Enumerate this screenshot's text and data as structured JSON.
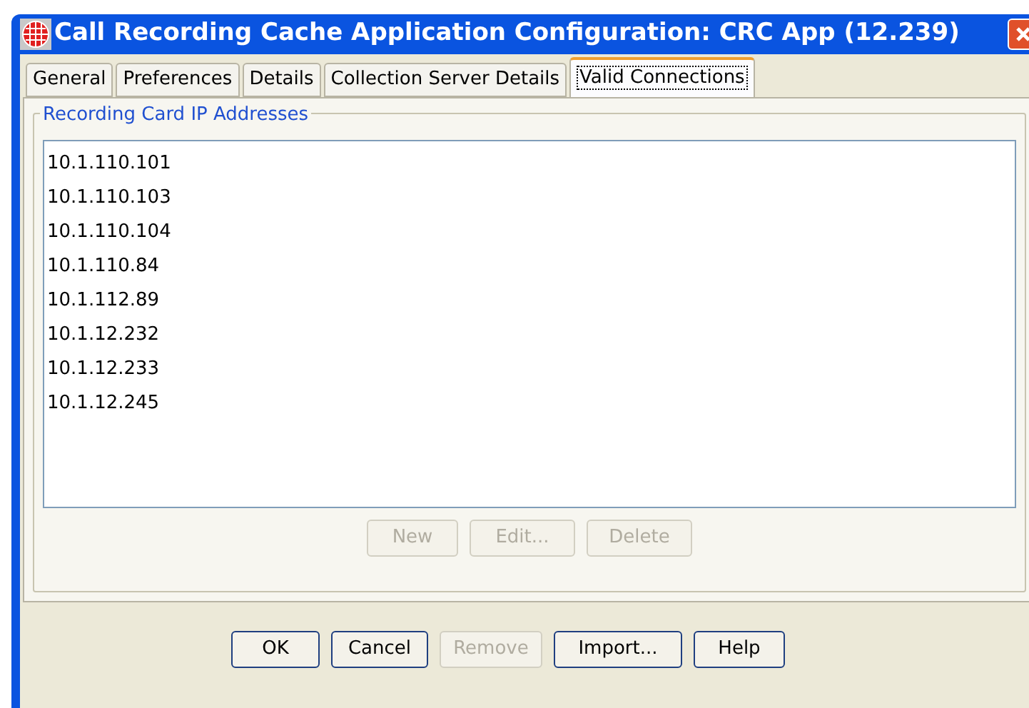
{
  "window": {
    "title": "Call Recording Cache Application Configuration: CRC App (12.239)"
  },
  "tabs": [
    {
      "label": "General",
      "selected": false
    },
    {
      "label": "Preferences",
      "selected": false
    },
    {
      "label": "Details",
      "selected": false
    },
    {
      "label": "Collection Server Details",
      "selected": false
    },
    {
      "label": "Valid Connections",
      "selected": true
    }
  ],
  "group": {
    "title": "Recording Card IP Addresses",
    "items": [
      "10.1.110.101",
      "10.1.110.103",
      "10.1.110.104",
      "10.1.110.84",
      "10.1.112.89",
      "10.1.12.232",
      "10.1.12.233",
      "10.1.12.245"
    ],
    "buttons": [
      {
        "label": "New",
        "disabled": true
      },
      {
        "label": "Edit...",
        "disabled": true
      },
      {
        "label": "Delete",
        "disabled": true
      }
    ]
  },
  "buttons": [
    {
      "label": "OK",
      "disabled": false
    },
    {
      "label": "Cancel",
      "disabled": false
    },
    {
      "label": "Remove",
      "disabled": true
    },
    {
      "label": "Import...",
      "disabled": false
    },
    {
      "label": "Help",
      "disabled": false
    }
  ]
}
